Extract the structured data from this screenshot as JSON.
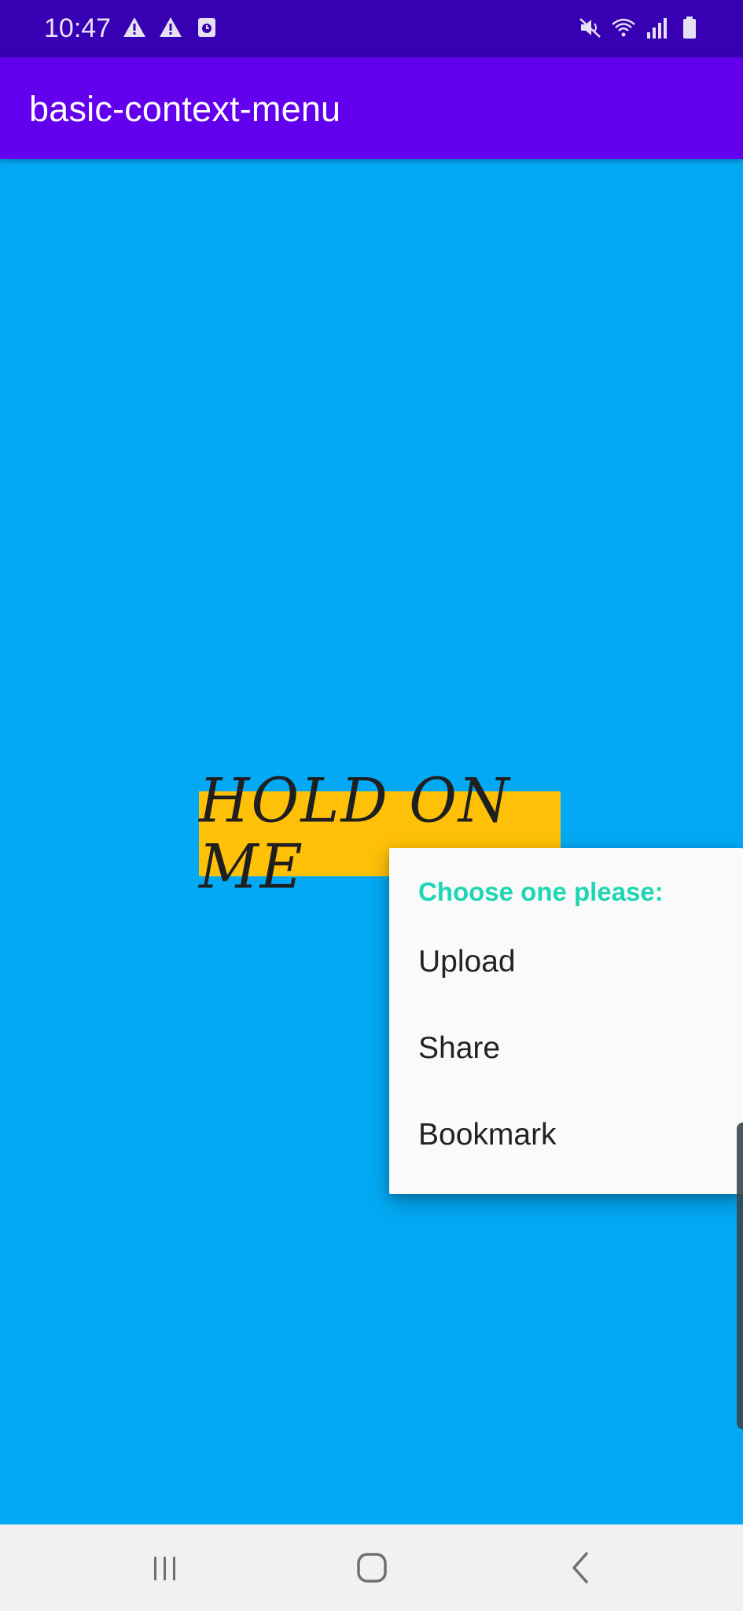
{
  "status_bar": {
    "time": "10:47",
    "left_icons": [
      "warning-icon",
      "warning-icon",
      "screen-recorder-icon"
    ],
    "right_icons": [
      "mute-icon",
      "wifi-icon",
      "signal-icon",
      "battery-icon"
    ]
  },
  "app_bar": {
    "title": "basic-context-menu"
  },
  "main": {
    "hold_button_label": "HOLD ON ME"
  },
  "context_menu": {
    "header": "Choose one please:",
    "items": [
      {
        "label": "Upload"
      },
      {
        "label": "Share"
      },
      {
        "label": "Bookmark"
      }
    ]
  },
  "nav_bar": {
    "buttons": [
      "recent-apps-icon",
      "home-icon",
      "back-icon"
    ]
  },
  "colors": {
    "background": "#03A9F4",
    "app_bar": "#6200EE",
    "status_bar": "#3700B3",
    "hold_button": "#FFC107",
    "menu_header": "#1ED6B4"
  }
}
